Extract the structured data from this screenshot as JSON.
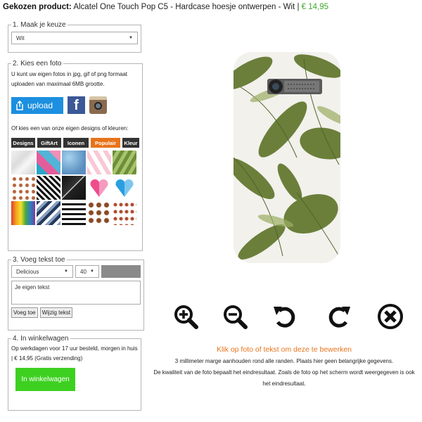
{
  "header": {
    "label": "Gekozen product:",
    "product": "Alcatel One Touch Pop C5 - Hardcase hoesje ontwerpen - Wit",
    "separator": "|",
    "price": "€ 14,95"
  },
  "section1": {
    "legend": "1. Maak je keuze",
    "select_value": "Wit"
  },
  "section2": {
    "legend": "2. Kies een foto",
    "description": "U kunt uw eigen fotos in jpg, gif of png formaat uploaden van maximaal 6MB grootte.",
    "upload_label": "upload",
    "designs_intro": "Of kies een van onze eigen designs of kleuren:",
    "tabs": [
      {
        "label": "Designs",
        "active": false
      },
      {
        "label": "GiftArt",
        "active": false
      },
      {
        "label": "Iconen",
        "active": false
      },
      {
        "label": "Populair",
        "active": true
      },
      {
        "label": "Kleur",
        "active": false
      }
    ],
    "tiles": [
      "marble",
      "tropical",
      "blue",
      "flamingo",
      "green",
      "dots",
      "chevron",
      "blackmarble",
      "heart-pink",
      "heart-blue",
      "paint",
      "zigzag",
      "stripes",
      "leopard",
      "camo"
    ]
  },
  "section3": {
    "legend": "3. Voeg tekst toe",
    "font_value": "Delicious",
    "size_value": "40",
    "text_placeholder": "Je eigen tekst",
    "add_button": "Voeg toe",
    "edit_button": "Wijzig tekst",
    "color_swatch": "#8a8a8a"
  },
  "section4": {
    "legend": "4. In winkelwagen",
    "delivery_text": "Op werkdagen voor 17 uur besteld, morgen in huis | € 14,95 (Gratis verzending)",
    "cart_button": "In winkelwagen"
  },
  "tools": [
    "zoom-in-icon",
    "zoom-out-icon",
    "rotate-left-icon",
    "rotate-right-icon",
    "delete-icon"
  ],
  "info": {
    "hint": "Klik op foto of tekst om deze te bewerken",
    "line1": "3 millimeter marge aanhouden rond alle randen. Plaats hier geen belangrijke gegevens.",
    "line2": "De kwaliteit van de foto bepaalt het eindresultaat. Zoals de foto op het scherm wordt weergegeven is ook",
    "line3": "het eindresultaat."
  },
  "colors": {
    "price_green": "#3fa82d",
    "accent_orange": "#e8731b",
    "upload_blue": "#1c8fe0",
    "cart_green": "#3dd021"
  }
}
